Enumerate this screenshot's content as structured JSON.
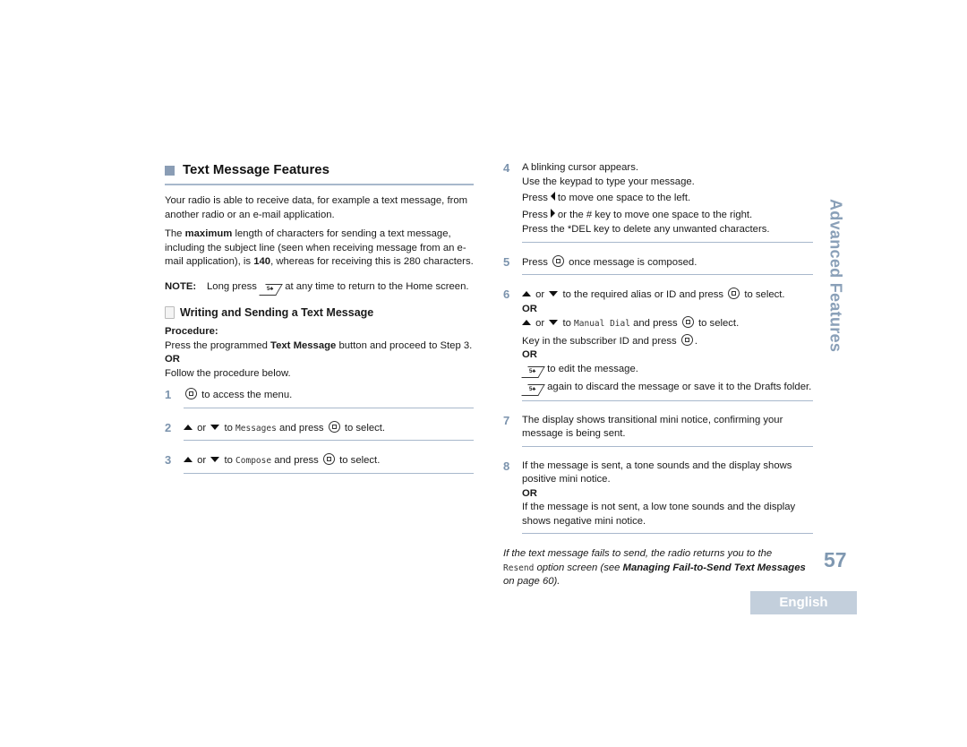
{
  "left": {
    "heading": "Text Message Features",
    "intro": "Your radio is able to receive data, for example a text message, from another radio or an e-mail application.",
    "max_para": {
      "pre": "The ",
      "bold1": "maximum",
      "mid": " length of characters for sending a text message, including the subject line (seen when receiving message from an e-mail application), is ",
      "bold2": "140",
      "post": ", whereas for receiving this is 280 characters."
    },
    "note": {
      "label": "NOTE:",
      "pre": "Long press",
      "post": "at any time to return to the Home screen.",
      "icon": "back-home-key-icon"
    },
    "subheading": "Writing and Sending a Text Message",
    "procedure_label": "Procedure:",
    "procedure_pre": "Press the programmed ",
    "procedure_bold": "Text Message",
    "procedure_post": " button and proceed to Step 3.",
    "or": "OR",
    "follow": "Follow the procedure below.",
    "steps": [
      {
        "num": "1",
        "text": "to access the menu."
      },
      {
        "num": "2",
        "or": "or",
        "to": "to",
        "mono": "Messages",
        "mid": "and press",
        "end": "to select."
      },
      {
        "num": "3",
        "or": "or",
        "to": "to",
        "mono": "Compose",
        "mid": "and press",
        "end": "to select."
      }
    ]
  },
  "right": {
    "steps": [
      {
        "num": "4",
        "lines": [
          "A blinking cursor appears.",
          "Use the keypad to type your message."
        ],
        "left_pre": "Press",
        "left_post": "to move one space to the left.",
        "right_pre": "Press",
        "right_post": "or the # key to move one space to the right.",
        "del": "Press the *DEL key to delete any unwanted characters."
      },
      {
        "num": "5",
        "pre": "Press",
        "post": "once message is composed."
      },
      {
        "num": "6",
        "a_or": "or",
        "a_post": "to the required alias or ID and press",
        "a_end": "to select.",
        "or": "OR",
        "b_or": "or",
        "b_to": "to",
        "b_mono": "Manual Dial",
        "b_mid": "and press",
        "b_end": "to select.",
        "c": "Key in the subscriber ID and press",
        "c_end": ".",
        "d": "to edit the message.",
        "e": "again to discard the message or save it to the Drafts folder."
      },
      {
        "num": "7",
        "text": "The display shows transitional mini notice, confirming your message is being sent."
      },
      {
        "num": "8",
        "a": "If the message is sent, a tone sounds and the display shows positive mini notice.",
        "or": "OR",
        "b": "If the message is not sent, a low tone sounds and the display shows negative mini notice."
      }
    ],
    "footer_note": {
      "pre": "If the text message fails to send, the radio returns you to the",
      "mono": "Resend",
      "mid": " option screen (see ",
      "bold": "Managing Fail-to-Send Text Messages",
      "post": " on page 60)."
    }
  },
  "side_tab": "Advanced Features",
  "page_number": "57",
  "language_tab": "English",
  "colors": {
    "accent": "#8aa0b8",
    "rule": "#a8b8cc",
    "language_tab_bg": "#c3cfdc"
  }
}
